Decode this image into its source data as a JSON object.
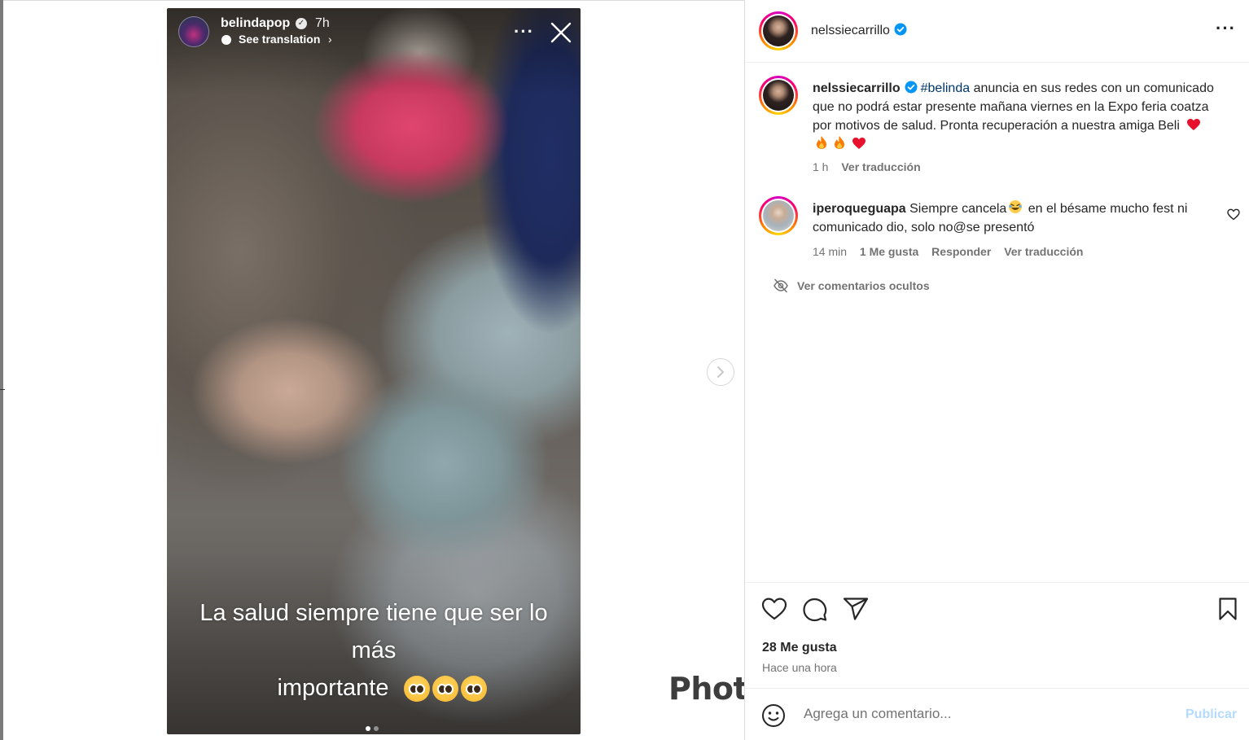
{
  "story": {
    "username": "belindapop",
    "time": "7h",
    "translate_label": "See translation",
    "caption_line1": "La salud siempre tiene que ser lo más",
    "caption_line2": "importante"
  },
  "watermark": "Photo",
  "post": {
    "header_username": "nelssiecarrillo",
    "caption": {
      "username": "nelssiecarrillo",
      "hashtag": "#belinda",
      "text": " anuncia en sus redes con un comunicado que no podrá estar presente mañana viernes en la Expo feria coatza por motivos de salud. Pronta recuperación a nuestra amiga Beli",
      "time": "1 h",
      "translate": "Ver traducción"
    },
    "comments": [
      {
        "username": "iperoqueguapa",
        "text_before": " Siempre cancela",
        "text_after": " en el bésame mucho fest ni comunicado dio, solo no@se presentó",
        "time": "14 min",
        "likes": "1 Me gusta",
        "reply": "Responder",
        "translate": "Ver traducción"
      }
    ],
    "hidden_comments": "Ver comentarios ocultos",
    "likes": "28 Me gusta",
    "posted": "Hace una hora",
    "comment_placeholder": "Agrega un comentario...",
    "publish": "Publicar"
  },
  "colors": {
    "verified": "#0095f6",
    "hashtag": "#00376b",
    "publish_disabled": "#b3dbff",
    "heart_red": "#e8112d",
    "fire": "#ff7a00"
  },
  "icons": [
    "close-icon",
    "more-icon",
    "chevron-right-icon",
    "verified-icon",
    "heart-icon",
    "comment-icon",
    "share-icon",
    "bookmark-icon",
    "emoji-icon",
    "hidden-eye-icon"
  ]
}
